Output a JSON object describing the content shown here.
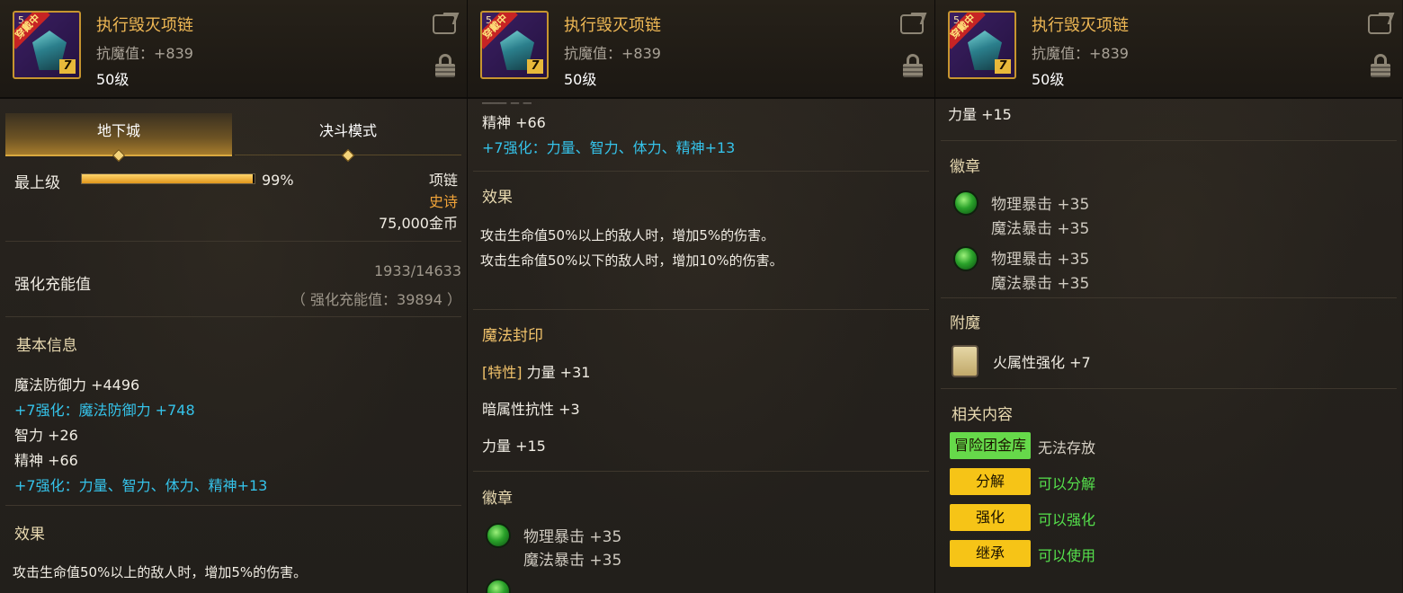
{
  "item": {
    "name": "执行毁灭项链",
    "stat": "抗魔值：+839",
    "level": "50级",
    "icon_badge": "穿戴中",
    "icon_level_prefix": "5",
    "icon_plus": "7"
  },
  "panel1": {
    "tabs": [
      {
        "label": "地下城",
        "active": true
      },
      {
        "label": "决斗模式",
        "active": false
      }
    ],
    "grade": "最上级",
    "grade_percent_text": "99%",
    "grade_percent": 0.99,
    "type": "项链",
    "rarity": "史诗",
    "price": "75,000金币",
    "charge_label": "强化充能值",
    "charge_value": "1933/14633",
    "charge_total": "（ 强化充能值：39894 ）",
    "basic_title": "基本信息",
    "basic_lines": [
      {
        "text": "魔法防御力 +4496",
        "color": "white"
      },
      {
        "text": "+7强化：魔法防御力 +748",
        "color": "cyan"
      },
      {
        "text": "智力 +26",
        "color": "white"
      },
      {
        "text": "精神 +66",
        "color": "white"
      },
      {
        "text": "+7强化：力量、智力、体力、精神+13",
        "color": "cyan"
      }
    ],
    "effect_title": "效果",
    "effect_line": "攻击生命值50%以上的敌人时，增加5%的伤害。"
  },
  "panel2": {
    "cut_line": "─── ─ ─",
    "line_spirit": "精神 +66",
    "line_enhance": "+7强化：力量、智力、体力、精神+13",
    "effect_title": "效果",
    "effect_lines": [
      "攻击生命值50%以上的敌人时，增加5%的伤害。",
      "攻击生命值50%以下的敌人时，增加10%的伤害。"
    ],
    "seal_title": "魔法封印",
    "seal_lines": [
      {
        "prefix": "[特性]",
        "text": " 力量 +31"
      },
      {
        "prefix": "",
        "text": "暗属性抗性 +3"
      },
      {
        "prefix": "",
        "text": "力量 +15"
      }
    ],
    "emblem_title": "徽章",
    "emblem1": [
      "物理暴击 +35",
      "魔法暴击 +35"
    ]
  },
  "panel3": {
    "top_line": "力量 +15",
    "emblem_title": "徽章",
    "emblems": [
      [
        "物理暴击 +35",
        "魔法暴击 +35"
      ],
      [
        "物理暴击 +35",
        "魔法暴击 +35"
      ]
    ],
    "enchant_title": "附魔",
    "enchant_text": "火属性强化 +7",
    "related_title": "相关内容",
    "related": [
      {
        "tag": "冒险团金库",
        "status": "无法存放",
        "tag_color": "#66d94a",
        "status_color": "#d8d2c6"
      },
      {
        "tag": "分解",
        "status": "可以分解",
        "tag_color": "#f6c417",
        "status_color": "#55e04c"
      },
      {
        "tag": "强化",
        "status": "可以强化",
        "tag_color": "#f6c417",
        "status_color": "#55e04c"
      },
      {
        "tag": "继承",
        "status": "可以使用",
        "tag_color": "#f6c417",
        "status_color": "#55e04c"
      }
    ]
  }
}
